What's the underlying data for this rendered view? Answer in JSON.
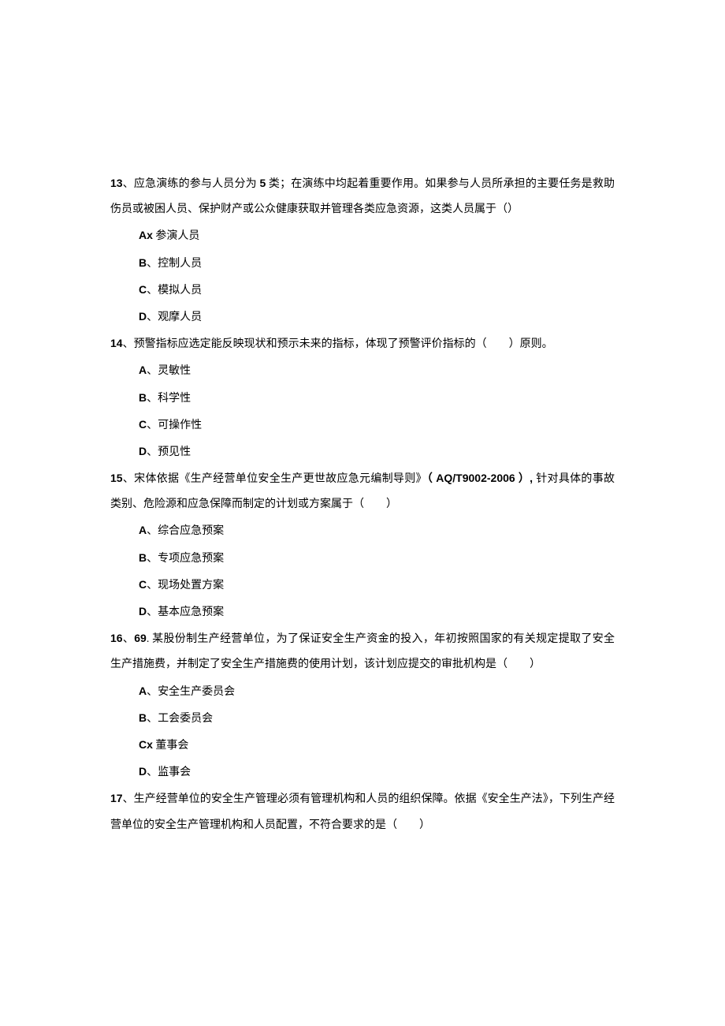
{
  "questions": [
    {
      "number": "13",
      "stem_parts": [
        "、应急演练的参与人员分为 ",
        "5",
        " 类；在演练中均起着重要作用。如果参与人员所承担的主要任务是救助伤员或被困人员、保护财产或公众健康获取并管理各类应急资源，这类人员属于（）"
      ],
      "options": [
        {
          "label": "Ax",
          "sep": " ",
          "text": "参演人员"
        },
        {
          "label": "B",
          "sep": "、",
          "text": "控制人员"
        },
        {
          "label": "C",
          "sep": "、",
          "text": "模拟人员"
        },
        {
          "label": "D",
          "sep": "、",
          "text": "观摩人员"
        }
      ]
    },
    {
      "number": "14",
      "stem_parts": [
        "、预警指标应选定能反映现状和预示未来的指标，体现了预警评价指标的（　　）原则。"
      ],
      "options": [
        {
          "label": "A",
          "sep": "、",
          "text": "灵敏性"
        },
        {
          "label": "B",
          "sep": "、",
          "text": "科学性"
        },
        {
          "label": "C",
          "sep": "、",
          "text": "可操作性"
        },
        {
          "label": "D",
          "sep": "、",
          "text": "预见性"
        }
      ]
    },
    {
      "number": "15",
      "stem_parts": [
        "、宋体依据《生产经营单位安全生产更世故应急元编制导则》",
        "（ AQ/T9002-2006 ）, ",
        "针对具体的事故类别、危险源和应急保障而制定的计划或方案属于（　　）"
      ],
      "options": [
        {
          "label": "A",
          "sep": "、",
          "text": "综合应急预案"
        },
        {
          "label": "B",
          "sep": "、",
          "text": "专项应急预案"
        },
        {
          "label": "C",
          "sep": "、",
          "text": "现场处置方案"
        },
        {
          "label": "D",
          "sep": "、",
          "text": "基本应急预案"
        }
      ]
    },
    {
      "number": "16",
      "stem_parts": [
        "、",
        "69",
        ". 某股份制生产经营单位，为了保证安全生产资金的投入，年初按照国家的有关规定提取了安全生产措施费，并制定了安全生产措施费的使用计划，该计划应提交的审批机构是（　　）"
      ],
      "options": [
        {
          "label": "A",
          "sep": "、",
          "text": "安全生产委员会"
        },
        {
          "label": "B",
          "sep": "、",
          "text": "工会委员会"
        },
        {
          "label": "Cx",
          "sep": " ",
          "text": "董事会"
        },
        {
          "label": "D",
          "sep": "、",
          "text": "监事会"
        }
      ]
    },
    {
      "number": "17",
      "stem_parts": [
        "、生产经营单位的安全生产管理必须有管理机构和人员的组织保障。依据《安全生产法》，下列生产经营单位的安全生产管理机构和人员配置，不符合要求的是（　　）"
      ],
      "options": []
    }
  ]
}
